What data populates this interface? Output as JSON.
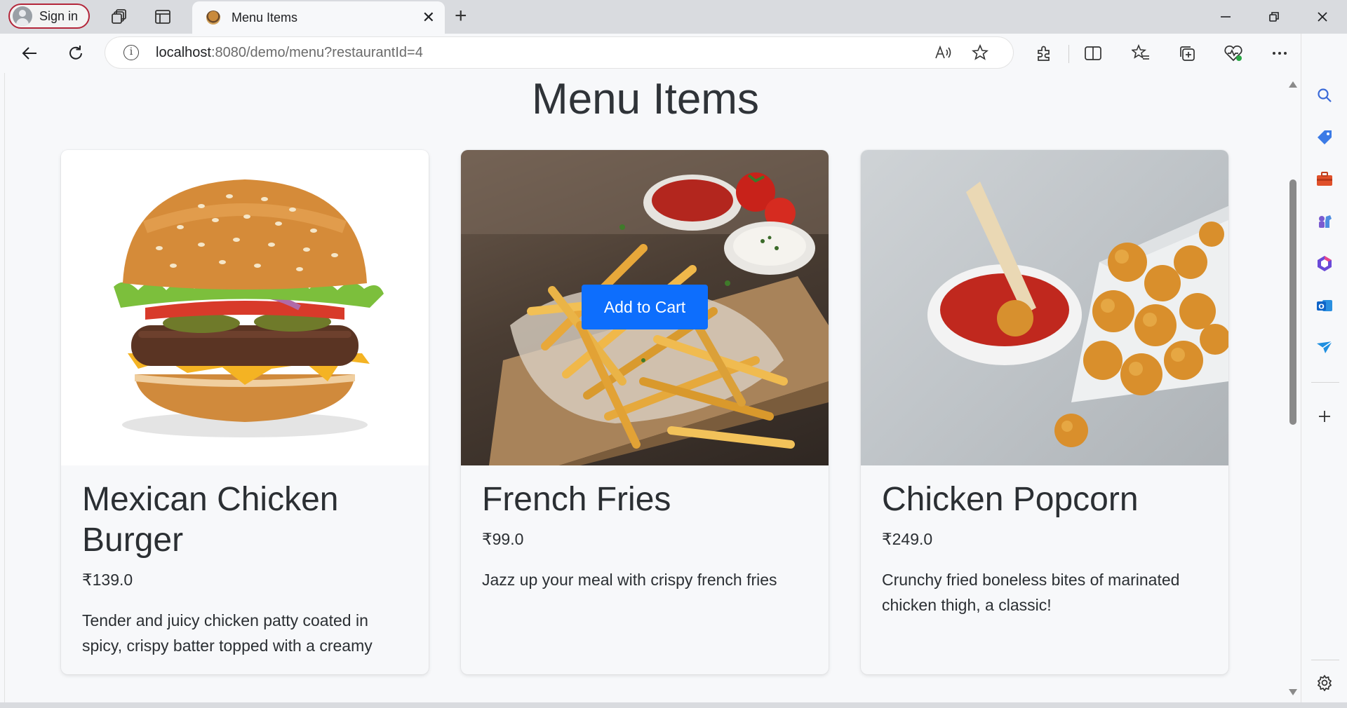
{
  "browser": {
    "signin_label": "Sign in",
    "tab_title": "Menu Items",
    "url_host": "localhost",
    "url_rest": ":8080/demo/menu?restaurantId=4"
  },
  "page": {
    "title": "Menu Items",
    "add_to_cart_label": "Add to Cart"
  },
  "items": [
    {
      "name": "Mexican Chicken Burger",
      "price": "₹139.0",
      "description": "Tender and juicy chicken patty coated in spicy, crispy batter topped with a creamy"
    },
    {
      "name": "French Fries",
      "price": "₹99.0",
      "description": "Jazz up your meal with crispy french fries"
    },
    {
      "name": "Chicken Popcorn",
      "price": "₹249.0",
      "description": "Crunchy fried boneless bites of marinated chicken thigh, a classic!"
    }
  ],
  "colors": {
    "primary_button": "#0d6efd",
    "signin_border": "#b3263a"
  }
}
